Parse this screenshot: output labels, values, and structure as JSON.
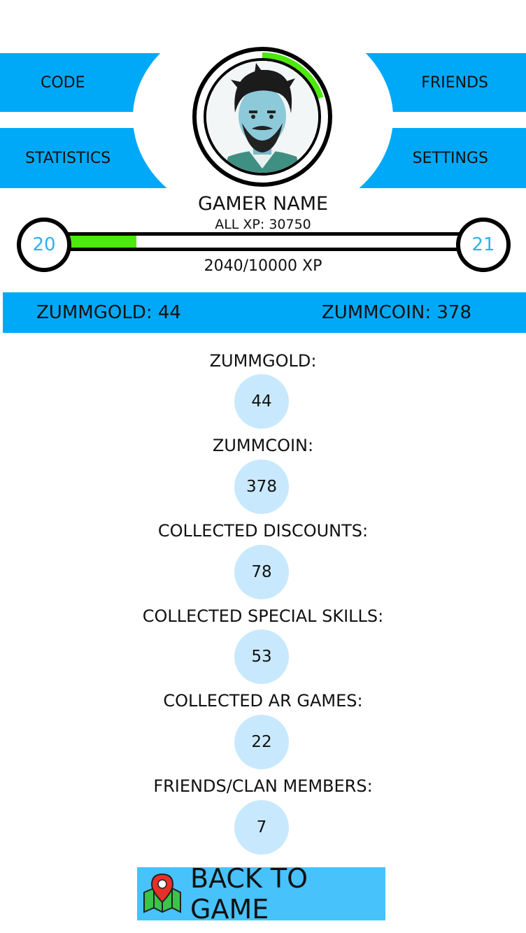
{
  "nav": {
    "code": "CODE",
    "statistics": "STATISTICS",
    "friends": "FRIENDS",
    "settings": "SETTINGS"
  },
  "profile": {
    "gamer_name": "GAMER NAME",
    "all_xp": "ALL XP: 30750",
    "avatar_ring_progress": 0.2,
    "ring_color": "#4de80c"
  },
  "level": {
    "current": "20",
    "next": "21",
    "xp_progress": "2040/10000 XP",
    "xp_fraction": 0.204,
    "bar_color": "#4de80c",
    "level_color": "#2eb0f2"
  },
  "currency": {
    "gold": "ZUMMGOLD: 44",
    "coin": "ZUMMCOIN: 378"
  },
  "stats": [
    {
      "label": "ZUMMGOLD:",
      "value": "44"
    },
    {
      "label": "ZUMMCOIN:",
      "value": "378"
    },
    {
      "label": "COLLECTED DISCOUNTS:",
      "value": "78"
    },
    {
      "label": "COLLECTED SPECIAL SKILLS:",
      "value": "53"
    },
    {
      "label": "COLLECTED AR GAMES:",
      "value": "22"
    },
    {
      "label": "FRIENDS/CLAN MEMBERS:",
      "value": "7"
    }
  ],
  "back_button": {
    "label": "BACK TO GAME",
    "icon": "map-pin-icon"
  },
  "colors": {
    "accent": "#00a9f8",
    "bubble": "#c8e9fd",
    "button": "#47c2fb"
  }
}
